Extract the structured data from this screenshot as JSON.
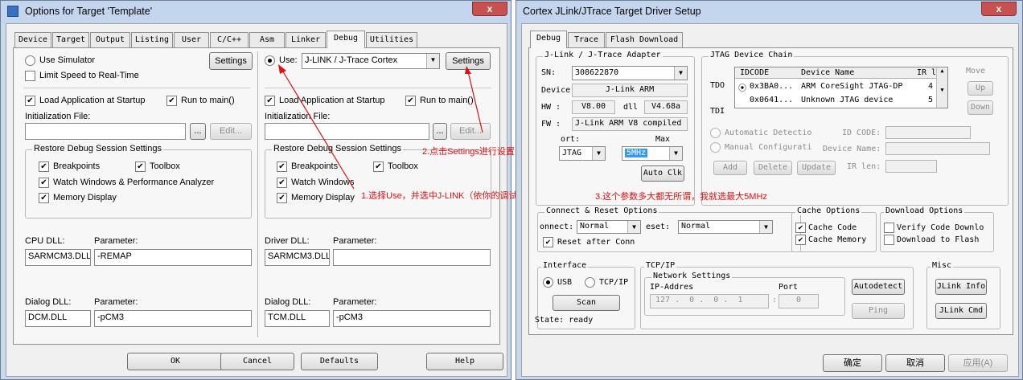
{
  "left": {
    "title": "Options for Target 'Template'",
    "close": "x",
    "tabs": [
      "Device",
      "Target",
      "Output",
      "Listing",
      "User",
      "C/C++",
      "Asm",
      "Linker",
      "Debug",
      "Utilities"
    ],
    "use_simulator": "Use Simulator",
    "limit_speed": "Limit Speed to Real-Time",
    "settings": "Settings",
    "use": "Use:",
    "driver": "J-LINK / J-Trace Cortex",
    "load_app": "Load Application at Startup",
    "run_main": "Run to main()",
    "init_file": "Initialization File:",
    "browse": "...",
    "edit": "Edit...",
    "restore": "Restore Debug Session Settings",
    "breakpoints": "Breakpoints",
    "toolbox": "Toolbox",
    "watch_perf": "Watch Windows & Performance Analyzer",
    "watch": "Watch Windows",
    "memory": "Memory Display",
    "cpu_dll": "CPU DLL:",
    "driver_dll": "Driver DLL:",
    "parameter": "Parameter:",
    "cpu_dll_val": "SARMCM3.DLL",
    "cpu_param_val": "-REMAP",
    "driver_dll_val": "SARMCM3.DLL",
    "dialog_dll": "Dialog DLL:",
    "dialog_dll_l": "DCM.DLL",
    "dialog_param_l": "-pCM3",
    "dialog_dll_r": "TCM.DLL",
    "dialog_param_r": "-pCM3",
    "ok": "OK",
    "cancel": "Cancel",
    "defaults": "Defaults",
    "help": "Help"
  },
  "right": {
    "title": "Cortex JLink/JTrace Target Driver Setup",
    "close": "x",
    "tabs": [
      "Debug",
      "Trace",
      "Flash Download"
    ],
    "adapter": "J-Link / J-Trace Adapter",
    "sn": "SN:",
    "sn_val": "308622870",
    "device": "Device:",
    "device_val": "J-Link ARM",
    "hw": "HW :",
    "hw_val": "V8.00",
    "dll": "dll",
    "dll_val": "V4.68a",
    "fw": "FW :",
    "fw_val": "J-Link ARM V8 compiled l",
    "port": "ort:",
    "port_val": "JTAG",
    "max": "Max",
    "max_val": "5MHz",
    "auto_clk": "Auto Clk",
    "chain": "JTAG Device Chain",
    "tdo": "TDO",
    "tdi": "TDI",
    "col_idcode": "IDCODE",
    "col_device": "Device Name",
    "col_ir": "IR l",
    "rows": [
      {
        "idcode": "0x3BA0...",
        "device": "ARM CoreSight JTAG-DP",
        "ir": "4"
      },
      {
        "idcode": "0x0641...",
        "device": "Unknown JTAG device",
        "ir": "5"
      }
    ],
    "move": "Move",
    "up": "Up",
    "down": "Down",
    "auto_detect": "Automatic Detectio",
    "manual_cfg": "Manual Configurati",
    "id_code": "ID CODE:",
    "device_name": "Device Name:",
    "ir_len": "IR len:",
    "add": "Add",
    "delete": "Delete",
    "update": "Update",
    "connect_reset": "Connect & Reset Options",
    "connect": "onnect:",
    "connect_val": "Normal",
    "reset": "eset:",
    "reset_val": "Normal",
    "reset_after": "Reset after Conn",
    "cache": "Cache Options",
    "cache_code": "Cache Code",
    "cache_mem": "Cache Memory",
    "download": "Download Options",
    "verify": "Verify Code Downlo",
    "dl_flash": "Download to Flash",
    "interface": "Interface",
    "usb": "USB",
    "tcpip": "TCP/IP",
    "scan": "Scan",
    "state": "State: ready",
    "tcpip_grp": "TCP/IP",
    "net": "Network Settings",
    "ip": "IP-Addres",
    "port_lbl": "Port",
    "ip1": "127",
    "ip2": "0",
    "ip3": "0",
    "ip4": "1",
    "port_val2": "0",
    "autodetect": "Autodetect",
    "ping": "Ping",
    "misc": "Misc",
    "jlink_info": "JLink Info",
    "jlink_cmd": "JLink Cmd",
    "ok": "确定",
    "cancel": "取消",
    "apply": "应用(A)"
  },
  "notes": {
    "n1": "1.选择Use，并选中J-LINK（依你的调试器所定）",
    "n2": "2.点击Settings进行设置",
    "n3": "3.这个参数多大都无所谓，我就选最大5MHz"
  },
  "colors": {
    "annotation": "#e01010",
    "title_bg": "#c3d6ee",
    "close_red": "#c75050"
  }
}
